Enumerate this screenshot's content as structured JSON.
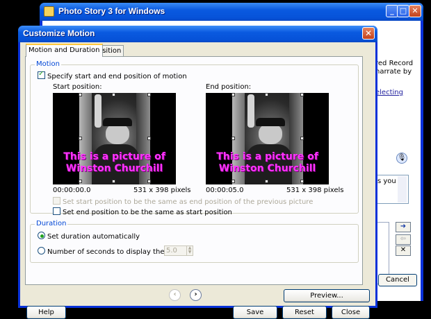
{
  "background_window": {
    "title": "Photo Story 3 for Windows",
    "side_text_lines": [
      "red Record",
      "narrate by"
    ],
    "side_link": "electing",
    "textbox_text": "s you",
    "cancel_label": "Cancel",
    "minimize_symbol": "_",
    "maximize_symbol": "□",
    "close_symbol": "✕",
    "nav_forward_symbol": "➜",
    "nav_back_symbol": "⇦",
    "nav_delete_symbol": "✕",
    "mic_symbol": "🎙"
  },
  "dialog": {
    "title": "Customize Motion",
    "close_symbol": "✕",
    "tabs": [
      {
        "label": "Motion and Duration",
        "active": true
      },
      {
        "label": "Transition",
        "active": false
      }
    ],
    "motion_group": {
      "legend": "Motion",
      "specify_checkbox": {
        "label": "Specify start and end position of motion",
        "checked": true
      },
      "start_label": "Start position:",
      "end_label": "End position:",
      "start_time": "00:00:00.0",
      "end_time": "00:00:05.0",
      "start_size": "531 x 398 pixels",
      "end_size": "531 x 398 pixels",
      "photo_caption_line1": "This is a picture of",
      "photo_caption_line2": "Winston Churchill",
      "same_start_checkbox": {
        "label": "Set start position to be the same as end position of the previous picture",
        "checked": false,
        "enabled": false
      },
      "same_end_checkbox": {
        "label": "Set end position to be the same as start position",
        "checked": false,
        "enabled": true
      }
    },
    "duration_group": {
      "legend": "Duration",
      "auto_radio": {
        "label": "Set duration automatically",
        "selected": true
      },
      "seconds_radio": {
        "label": "Number of seconds to display the picture",
        "selected": false
      },
      "seconds_value": "5.0"
    },
    "nav": {
      "prev_symbol": "‹",
      "next_symbol": "›"
    },
    "buttons": {
      "preview": "Preview...",
      "help": "Help",
      "save": "Save",
      "reset": "Reset",
      "close": "Close"
    }
  },
  "colors": {
    "title_bar": "#0a5ae0",
    "dialog_face": "#ece9d8",
    "group_legend": "#0046d5",
    "caption_text": "#ff33ff",
    "check_mark": "#21a121"
  }
}
